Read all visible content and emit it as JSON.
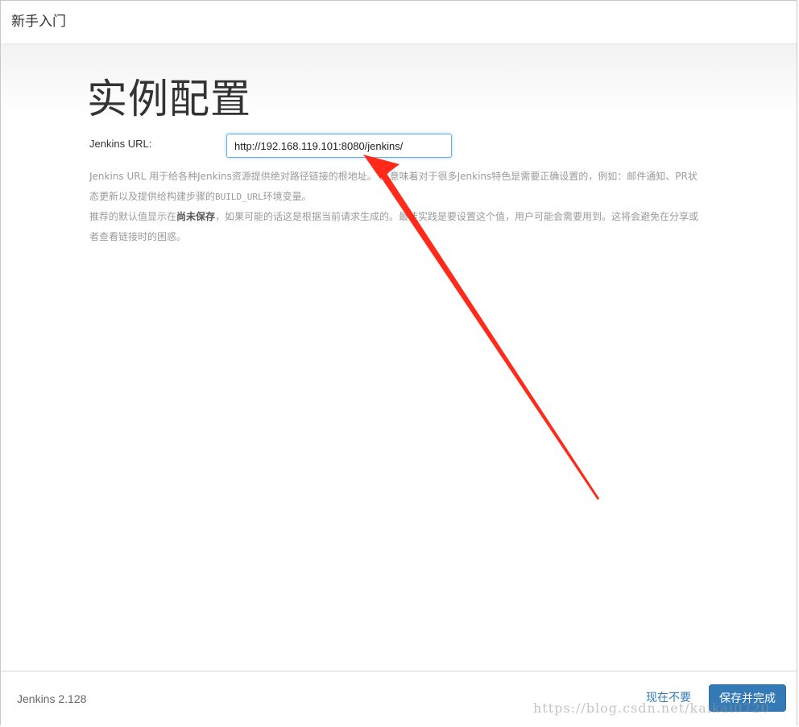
{
  "header": {
    "title": "新手入门"
  },
  "main": {
    "title": "实例配置",
    "url_label": "Jenkins URL:",
    "url_value": "http://192.168.119.101:8080/jenkins/",
    "help": {
      "p1_text": "Jenkins URL 用于给各种Jenkins资源提供绝对路径链接的根地址。 这意味着对于很多Jenkins特色是需要正确设置的，例如：邮件通知、PR状态更新以及提供给构建步骤的",
      "p1_code": "BUILD_URL",
      "p1_tail": "环境变量。",
      "p2_prefix": "推荐的默认值显示在",
      "p2_bold": "尚未保存",
      "p2_suffix": "，如果可能的话这是根据当前请求生成的。最佳实践是要设置这个值，用户可能会需要用到。这将会避免在分享或者查看链接时的困惑。"
    }
  },
  "footer": {
    "version": "Jenkins 2.128",
    "skip_label": "现在不要",
    "save_label": "保存并完成"
  },
  "annotation": {
    "arrow_color": "#ff2a1a"
  },
  "watermark": "https://blog.csdn.net/kaikai0720"
}
